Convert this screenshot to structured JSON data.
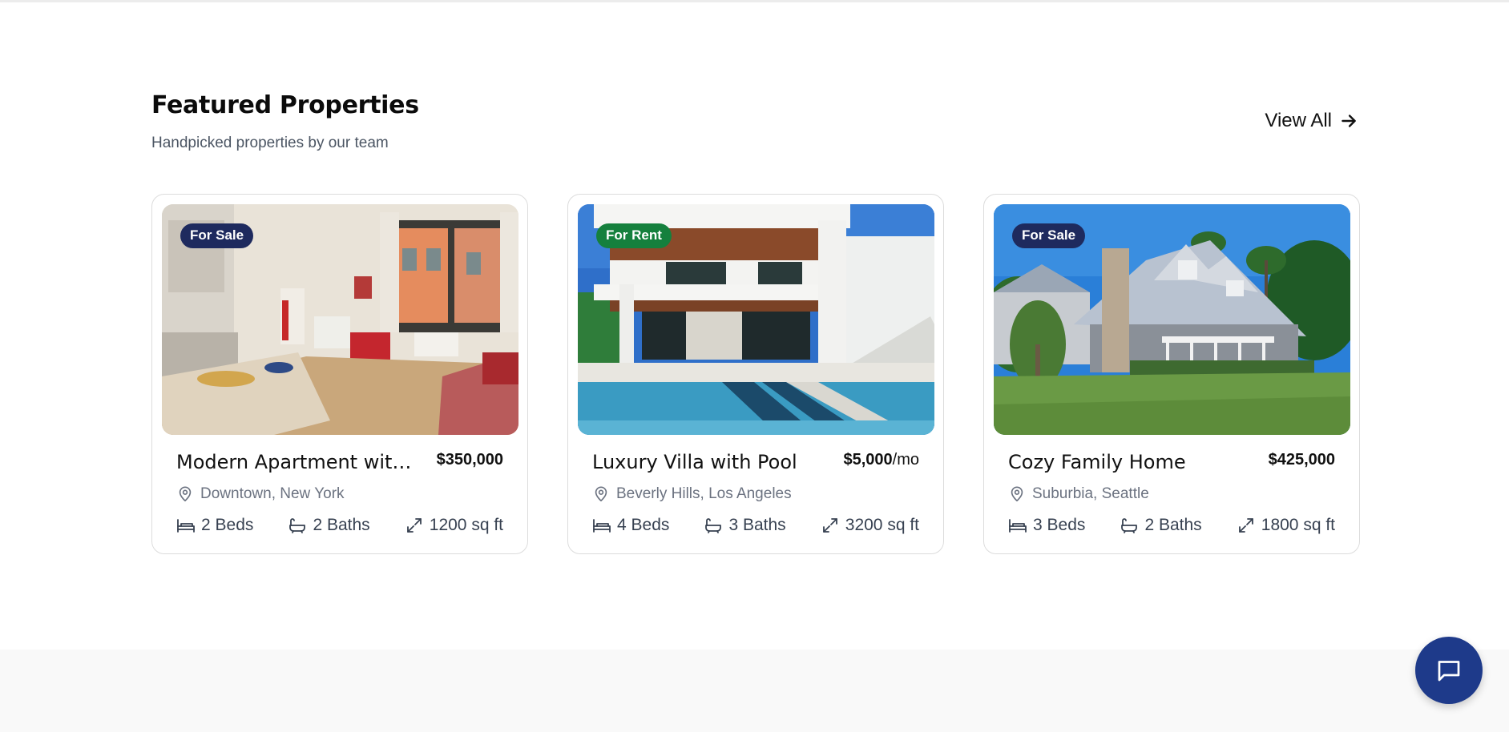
{
  "section": {
    "title": "Featured Properties",
    "subtitle": "Handpicked properties by our team",
    "view_all_label": "View All"
  },
  "colors": {
    "sale_badge": "#1e2a5e",
    "rent_badge": "#15803d",
    "chat_button": "#1e3a8a"
  },
  "properties": [
    {
      "badge": "For Sale",
      "badge_color": "#1e2a5e",
      "title": "Modern Apartment with City View",
      "price": "$350,000",
      "price_suffix": "",
      "location": "Downtown, New York",
      "beds": "2 Beds",
      "baths": "2 Baths",
      "area": "1200 sq ft",
      "image": "apartment-interior"
    },
    {
      "badge": "For Rent",
      "badge_color": "#15803d",
      "title": "Luxury Villa with Pool",
      "price": "$5,000",
      "price_suffix": "/mo",
      "location": "Beverly Hills, Los Angeles",
      "beds": "4 Beds",
      "baths": "3 Baths",
      "area": "3200 sq ft",
      "image": "villa-with-pool"
    },
    {
      "badge": "For Sale",
      "badge_color": "#1e2a5e",
      "title": "Cozy Family Home",
      "price": "$425,000",
      "price_suffix": "",
      "location": "Suburbia, Seattle",
      "beds": "3 Beds",
      "baths": "2 Baths",
      "area": "1800 sq ft",
      "image": "family-house"
    }
  ],
  "icons": {
    "location": "map-pin-icon",
    "beds": "bed-icon",
    "baths": "bath-icon",
    "area": "expand-icon",
    "view_all": "arrow-right-icon",
    "chat": "chat-icon"
  }
}
